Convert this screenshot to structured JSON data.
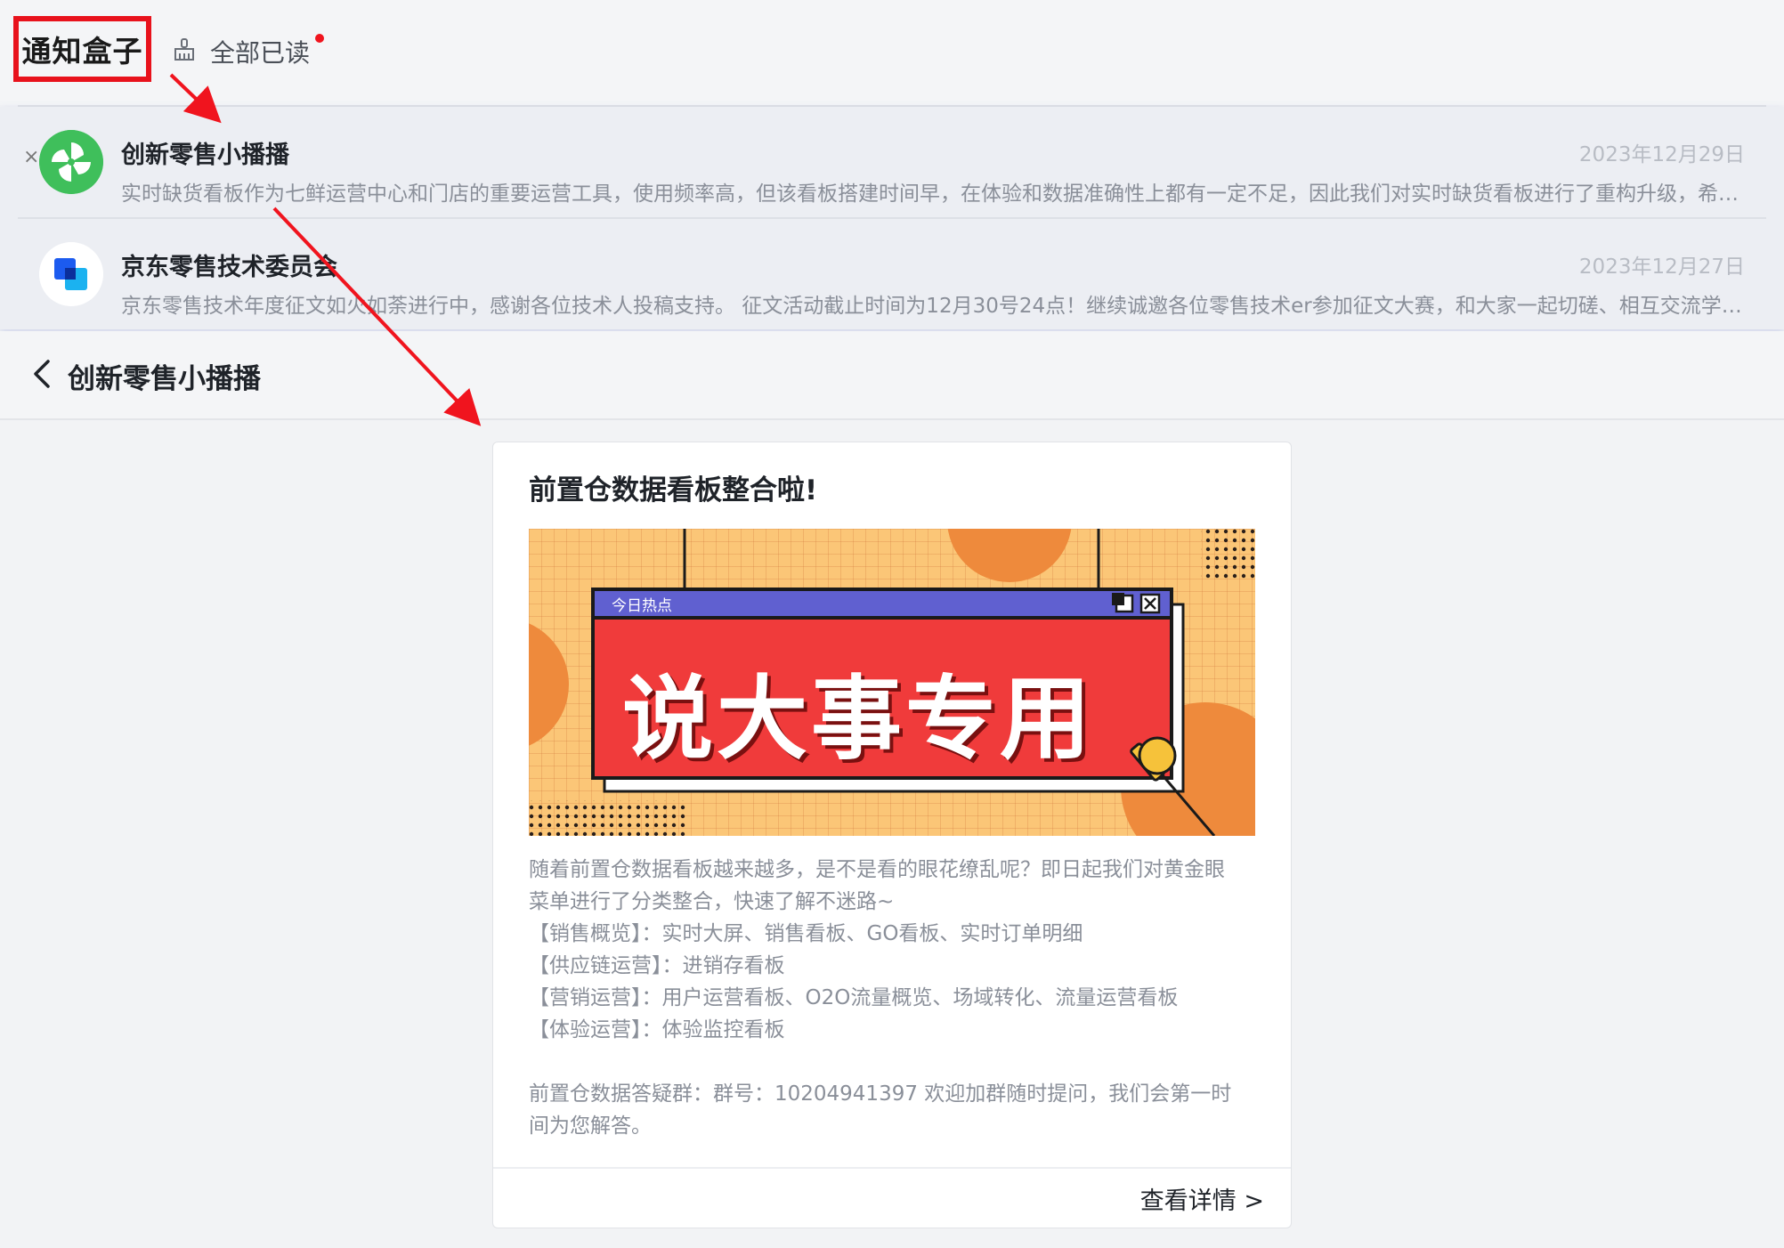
{
  "header": {
    "title": "通知盒子",
    "mark_all_read": "全部已读",
    "mark_all_icon": "broom-icon",
    "unread_indicator_color": "#f0141e"
  },
  "notifications": [
    {
      "sender": "创新零售小播播",
      "date": "2023年12月29日",
      "preview": "实时缺货看板作为七鲜运营中心和门店的重要运营工具，使用频率高，但该看板搭建时间早，在体验和数据准确性上都有一定不足，因此我们对实时缺货看板进行了重构升级，希望为大家带来更好的使用体验。",
      "close_label": "×",
      "avatar_icon": "pinwheel-icon",
      "avatar_color": "#3fbf5b"
    },
    {
      "sender": "京东零售技术委员会",
      "date": "2023年12月27日",
      "preview": "京东零售技术年度征文如火如荼进行中，感谢各位技术人投稿支持。 征文活动截止时间为12月30号24点！继续诚邀各位零售技术er参加征文大赛，和大家一起切磋、相互交流学习。",
      "avatar_icon": "overlapping-squares-icon"
    }
  ],
  "detail": {
    "back_icon": "chevron-left-icon",
    "title": "创新零售小播播"
  },
  "card": {
    "title": "前置仓数据看板整合啦!",
    "banner": {
      "tag": "今日热点",
      "text": "说大事专用",
      "icons": [
        "window-restore-icon",
        "window-close-icon",
        "microphone-icon"
      ],
      "colors": {
        "background": "#fbc677",
        "panel": "#f03b3b",
        "titlebar": "#6060d0",
        "circles": "#ee8a3c"
      }
    },
    "body_lines": [
      "随着前置仓数据看板越来越多，是不是看的眼花缭乱呢？即日起我们对黄金眼",
      "菜单进行了分类整合，快速了解不迷路~",
      "【销售概览】：实时大屏、销售看板、GO看板、实时订单明细",
      "【供应链运营】：进销存看板",
      "【营销运营】：用户运营看板、O2O流量概览、场域转化、流量运营看板",
      "【体验运营】：体验监控看板"
    ],
    "contact_lines": [
      "前置仓数据答疑群：群号：10204941397 欢迎加群随时提问，我们会第一时",
      "间为您解答。"
    ],
    "detail_link": "查看详情 >"
  },
  "annotations": {
    "highlight_color": "#e8121c",
    "arrow_color": "#f0141e"
  }
}
